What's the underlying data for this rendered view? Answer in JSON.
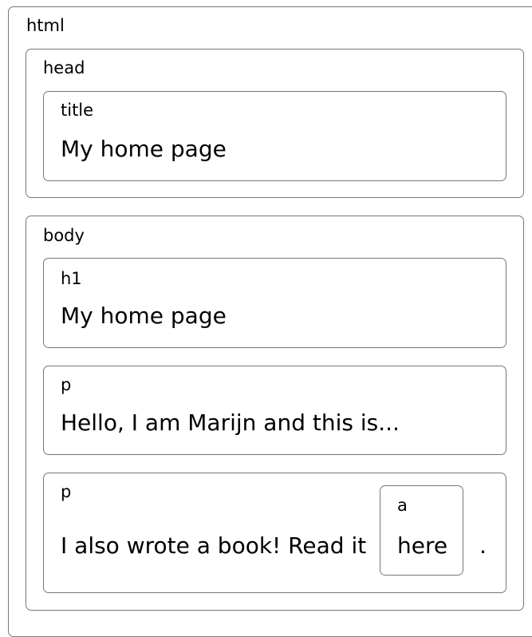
{
  "html": {
    "tag": "html"
  },
  "head": {
    "tag": "head",
    "title": {
      "tag": "title",
      "text": "My home page"
    }
  },
  "body": {
    "tag": "body",
    "h1": {
      "tag": "h1",
      "text": "My home page"
    },
    "p1": {
      "tag": "p",
      "text": "Hello, I am Marijn and this is..."
    },
    "p2": {
      "tag": "p",
      "text_before": "I also wrote a book! Read it",
      "link": {
        "tag": "a",
        "text": "here"
      },
      "text_after": "."
    }
  }
}
